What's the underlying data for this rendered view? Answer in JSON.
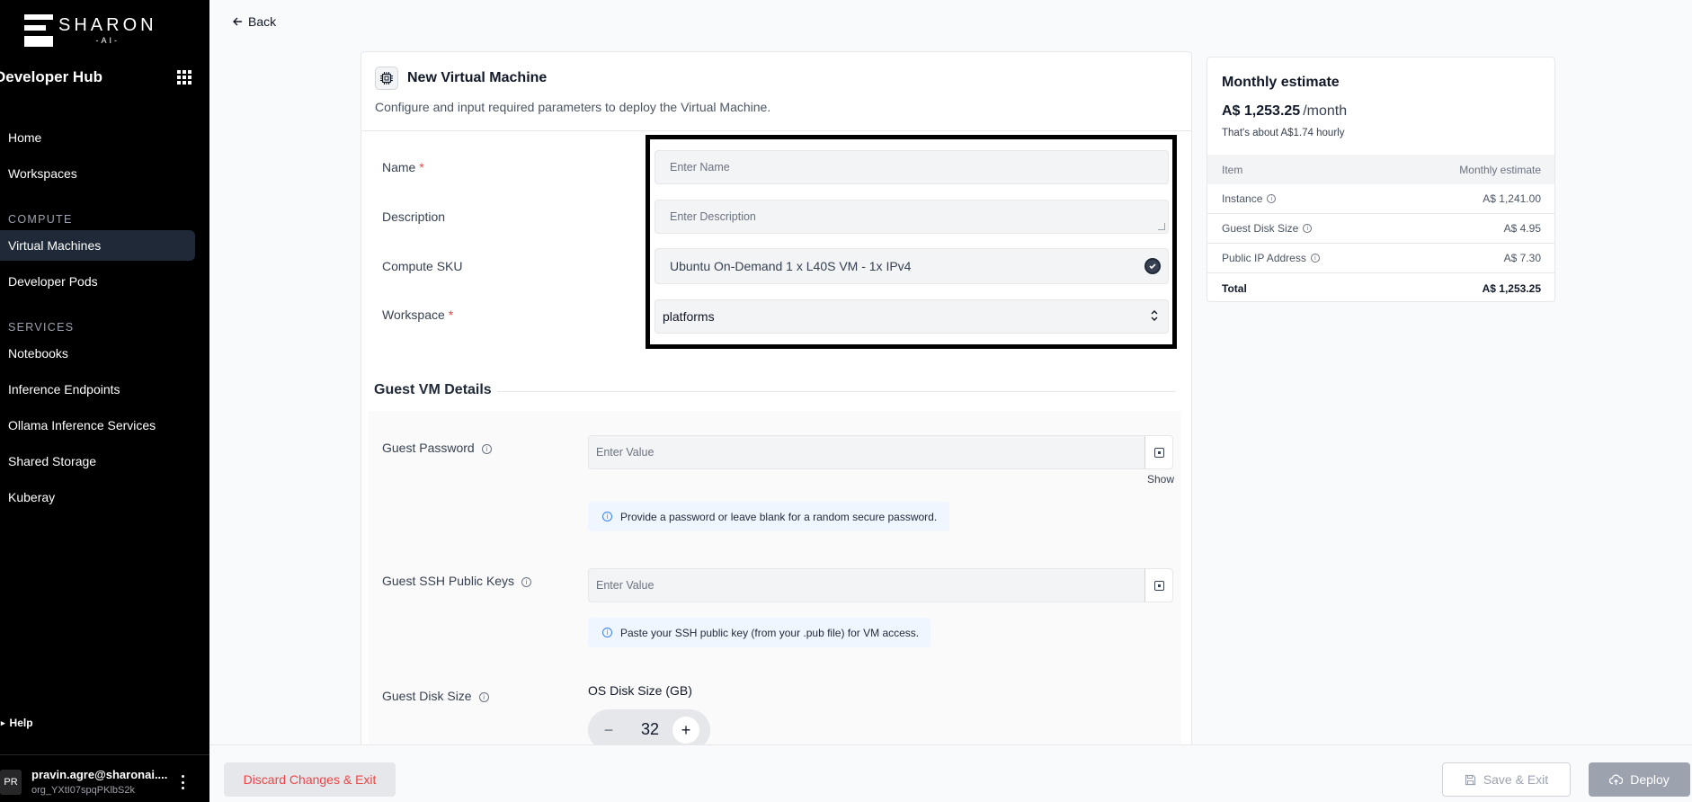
{
  "brand": {
    "name": "SHARON",
    "sub": "-AI-"
  },
  "sidebar": {
    "hub_title": "Developer Hub",
    "items": [
      {
        "label": "Home"
      },
      {
        "label": "Workspaces"
      },
      {
        "label": "Virtual Machines",
        "active": true
      },
      {
        "label": "Developer Pods"
      },
      {
        "label": "Notebooks"
      },
      {
        "label": "Inference Endpoints"
      },
      {
        "label": "Ollama Inference Services"
      },
      {
        "label": "Shared Storage"
      },
      {
        "label": "Kuberay"
      }
    ],
    "sections": {
      "compute": "COMPUTE",
      "services": "SERVICES"
    },
    "help": "Help",
    "user": {
      "initials": "PR",
      "email": "pravin.agre@sharonai....",
      "org": "org_YXtI07spqPKlbS2k"
    }
  },
  "nav": {
    "back": "Back"
  },
  "form": {
    "title": "New Virtual Machine",
    "subtitle": "Configure and input required parameters to deploy the Virtual Machine.",
    "name": {
      "label": "Name",
      "required": "*",
      "placeholder": "Enter Name"
    },
    "description": {
      "label": "Description",
      "placeholder": "Enter Description"
    },
    "compute_sku": {
      "label": "Compute SKU",
      "value": "Ubuntu On-Demand 1 x L40S VM - 1x IPv4"
    },
    "workspace": {
      "label": "Workspace",
      "required": "*",
      "value": "platforms"
    },
    "guest_section": "Guest VM Details",
    "guest_password": {
      "label": "Guest Password",
      "placeholder": "Enter Value",
      "show": "Show",
      "hint": "Provide a password or leave blank for a random secure password."
    },
    "guest_ssh": {
      "label": "Guest SSH Public Keys",
      "placeholder": "Enter Value",
      "hint": "Paste your SSH public key (from your .pub file) for VM access."
    },
    "guest_disk": {
      "label": "Guest Disk Size",
      "os_label": "OS Disk Size (GB)",
      "value": "32"
    }
  },
  "estimate": {
    "title": "Monthly estimate",
    "price": "A$ 1,253.25",
    "per": "/month",
    "hourly": "That's about A$1.74 hourly",
    "header": {
      "item": "Item",
      "value": "Monthly estimate"
    },
    "rows": [
      {
        "label": "Instance",
        "value": "A$ 1,241.00"
      },
      {
        "label": "Guest Disk Size",
        "value": "A$ 4.95"
      },
      {
        "label": "Public IP Address",
        "value": "A$ 7.30"
      }
    ],
    "total": {
      "label": "Total",
      "value": "A$ 1,253.25"
    }
  },
  "footer": {
    "discard": "Discard Changes & Exit",
    "save": "Save & Exit",
    "deploy": "Deploy"
  }
}
